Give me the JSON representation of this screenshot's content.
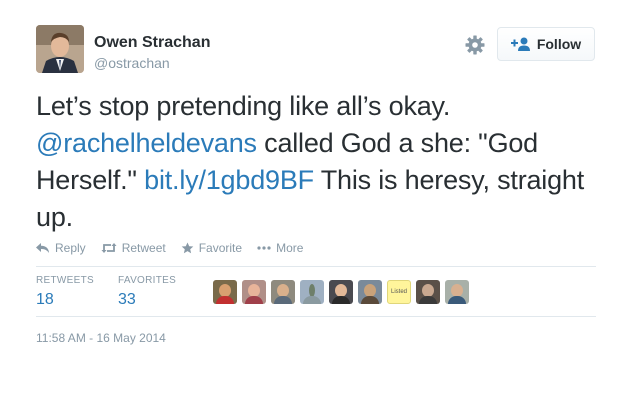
{
  "user": {
    "name": "Owen Strachan",
    "handle": "@ostrachan"
  },
  "follow_button": {
    "label": "Follow"
  },
  "tweet": {
    "segments": [
      {
        "text": "Let’s stop pretending like all’s okay. ",
        "link": false
      },
      {
        "text": "@rachelheldevans",
        "link": true
      },
      {
        "text": " called God a she: \"God Herself.\" ",
        "link": false
      },
      {
        "text": "bit.ly/1gbd9BF",
        "link": true
      },
      {
        "text": " This is heresy, straight up.",
        "link": false
      }
    ]
  },
  "actions": {
    "reply": "Reply",
    "retweet": "Retweet",
    "favorite": "Favorite",
    "more": "More"
  },
  "stats": {
    "retweets_label": "RETWEETS",
    "retweets_value": "18",
    "favorites_label": "FAVORITES",
    "favorites_value": "33"
  },
  "favoriters": {
    "listed_label": "Listed"
  },
  "timestamp": "11:58 AM - 16 May 2014",
  "colors": {
    "link": "#2b7bb9",
    "muted": "#8899a6",
    "text": "#292f33"
  }
}
